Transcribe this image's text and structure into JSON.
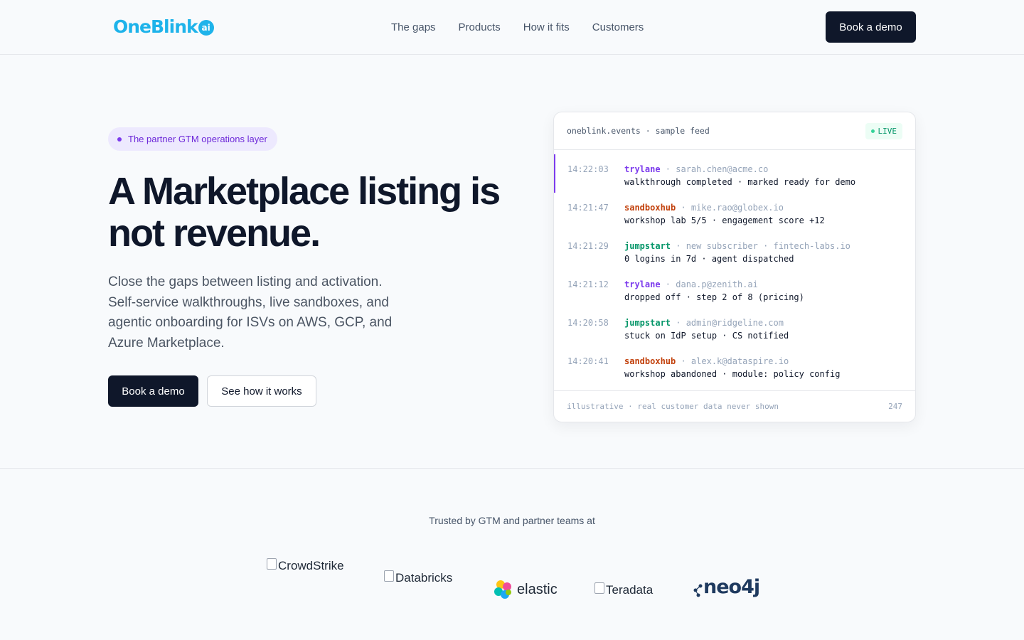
{
  "header": {
    "logo_text": "OneBlink",
    "logo_badge": "ai",
    "nav": [
      "The gaps",
      "Products",
      "How it fits",
      "Customers"
    ],
    "cta": "Book a demo"
  },
  "hero": {
    "pill": "The partner GTM operations layer",
    "title": "A Marketplace listing is not revenue.",
    "subtitle": "Close the gaps between listing and activation. Self-service walkthroughs, live sandboxes, and agentic onboarding for ISVs on AWS, GCP, and Azure Marketplace.",
    "primary_cta": "Book a demo",
    "secondary_cta": "See how it works"
  },
  "feed": {
    "title": "oneblink.events · sample feed",
    "status": "LIVE",
    "events": [
      {
        "time": "14:22:03",
        "source": "trylane",
        "meta": " · sarah.chen@acme.co",
        "message": "walkthrough completed · marked ready for demo"
      },
      {
        "time": "14:21:47",
        "source": "sandboxhub",
        "meta": " · mike.rao@globex.io",
        "message": "workshop lab 5/5 · engagement score +12"
      },
      {
        "time": "14:21:29",
        "source": "jumpstart",
        "meta": " · new subscriber · fintech-labs.io",
        "message": "0 logins in 7d · agent dispatched"
      },
      {
        "time": "14:21:12",
        "source": "trylane",
        "meta": " · dana.p@zenith.ai",
        "message": "dropped off · step 2 of 8 (pricing)"
      },
      {
        "time": "14:20:58",
        "source": "jumpstart",
        "meta": " · admin@ridgeline.com",
        "message": "stuck on IdP setup · CS notified"
      },
      {
        "time": "14:20:41",
        "source": "sandboxhub",
        "meta": " · alex.k@dataspire.io",
        "message": "workshop abandoned · module: policy config"
      }
    ],
    "footer_note": "illustrative · real customer data never shown",
    "footer_count": "247"
  },
  "trusted": {
    "label": "Trusted by GTM and partner teams at",
    "logos": [
      "CrowdStrike",
      "Databricks",
      "elastic",
      "Teradata",
      "neo4j"
    ]
  },
  "colors": {
    "brand": "#1eb3ea",
    "dark": "#0f172a",
    "accent_purple": "#7c3aed",
    "accent_orange": "#c2410c",
    "accent_green": "#059669"
  }
}
